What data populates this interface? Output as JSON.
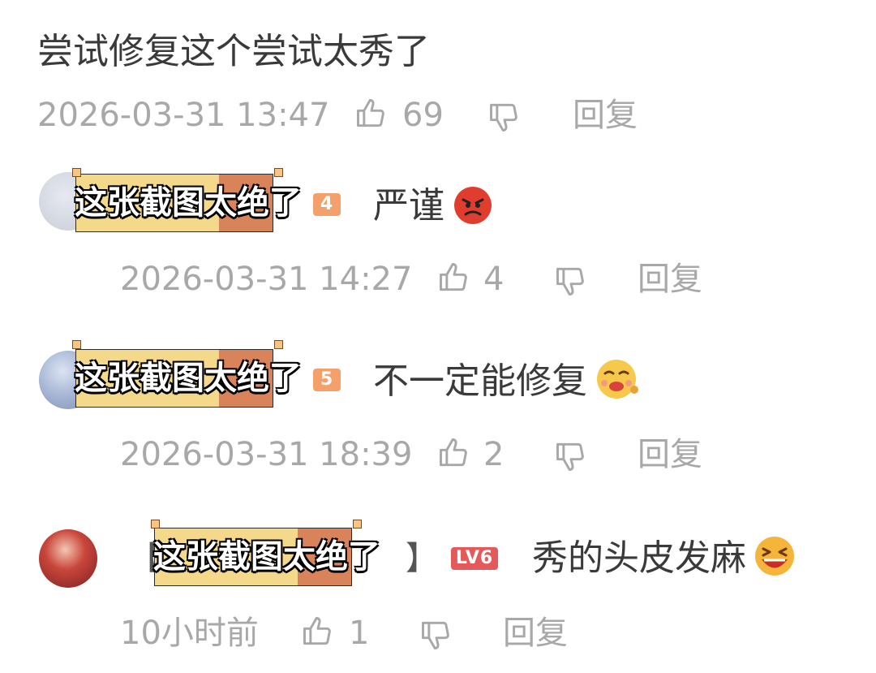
{
  "top_comment": {
    "text": "尝试修复这个尝试太秀了",
    "timestamp": "2026-03-31 13:47",
    "likes": "69",
    "reply_label": "回复"
  },
  "replies": [
    {
      "caption": "这张截图太绝了",
      "level_badge": "4",
      "text": "严谨",
      "emoji": "angry-face-emoji",
      "timestamp": "2026-03-31 14:27",
      "likes": "4",
      "reply_label": "回复"
    },
    {
      "caption": "这张截图太绝了",
      "level_badge": "5",
      "text": "不一定能修复",
      "emoji": "drooling-face-emoji",
      "timestamp": "2026-03-31 18:39",
      "likes": "2",
      "reply_label": "回复"
    },
    {
      "caption": "这张截图太绝了",
      "bracket_open": "【",
      "bracket_close": "】",
      "level_badge": "LV6",
      "text": "秀的头皮发麻",
      "emoji": "laughing-face-emoji",
      "timestamp": "10小时前",
      "likes": "1",
      "reply_label": "回复"
    }
  ],
  "colors": {
    "caption_bg_left": "#f5d98a",
    "caption_bg_right": "#d9835a",
    "badge_orange": "#f4a06a",
    "badge_red": "#e45a5a",
    "meta_gray": "#a8a8a8"
  }
}
